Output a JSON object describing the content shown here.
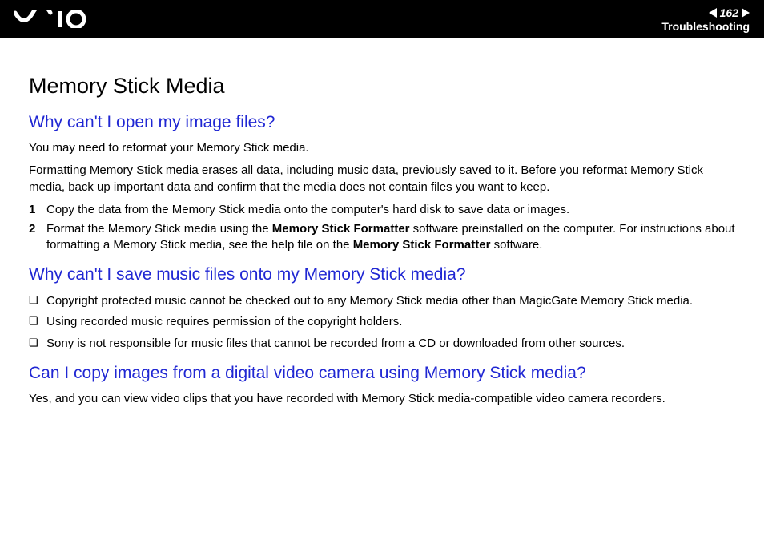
{
  "header": {
    "page_number": "162",
    "section": "Troubleshooting"
  },
  "title": "Memory Stick Media",
  "q1": {
    "heading": "Why can't I open my image files?",
    "p1": "You may need to reformat your Memory Stick media.",
    "p2": "Formatting Memory Stick media erases all data, including music data, previously saved to it. Before you reformat Memory Stick media, back up important data and confirm that the media does not contain files you want to keep.",
    "steps": [
      {
        "num": "1",
        "text": "Copy the data from the Memory Stick media onto the computer's hard disk to save data or images."
      },
      {
        "num": "2",
        "prefix": "Format the Memory Stick media using the ",
        "bold1": "Memory Stick Formatter",
        "mid": " software preinstalled on the computer. For instructions about formatting a Memory Stick media, see the help file on the ",
        "bold2": "Memory Stick Formatter",
        "suffix": " software."
      }
    ]
  },
  "q2": {
    "heading": "Why can't I save music files onto my Memory Stick media?",
    "bullets": [
      "Copyright protected music cannot be checked out to any Memory Stick media other than MagicGate Memory Stick media.",
      "Using recorded music requires permission of the copyright holders.",
      "Sony is not responsible for music files that cannot be recorded from a CD or downloaded from other sources."
    ]
  },
  "q3": {
    "heading": "Can I copy images from a digital video camera using Memory Stick media?",
    "p1": "Yes, and you can view video clips that you have recorded with Memory Stick media-compatible video camera recorders."
  }
}
